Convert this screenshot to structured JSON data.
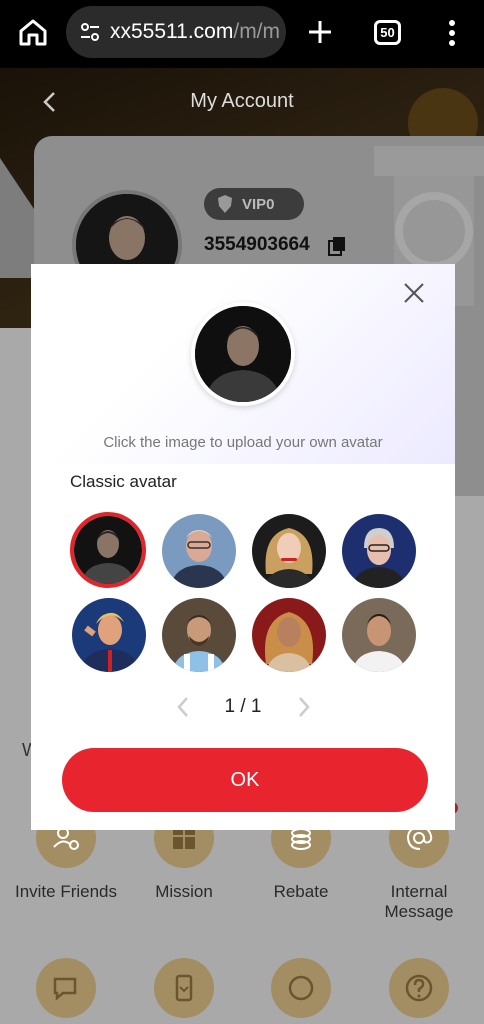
{
  "browser": {
    "url_host": "xx55511.com",
    "url_path": "/m/m",
    "tab_count": "50"
  },
  "app": {
    "title": "My Account",
    "vip_level": "VIP0",
    "user_id": "3554903664",
    "partial_label": "W",
    "menu": [
      {
        "label": "Invite Friends",
        "icon": "invite-user-icon"
      },
      {
        "label": "Mission",
        "icon": "gift-box-icon"
      },
      {
        "label": "Rebate",
        "icon": "coins-icon"
      },
      {
        "label": "Internal Message",
        "icon": "at-sign-icon"
      },
      {
        "icon": "feedback-chat-icon"
      },
      {
        "icon": "app-download-icon"
      },
      {
        "icon": "support-24-7-icon"
      },
      {
        "icon": "help-question-icon"
      }
    ]
  },
  "modal": {
    "upload_hint": "Click the image to upload your own avatar",
    "classic_label": "Classic avatar",
    "page_current": "1",
    "page_separator": "/",
    "page_total": "1",
    "ok_label": "OK",
    "avatars": [
      {
        "name": "avatar-1",
        "selected": true
      },
      {
        "name": "avatar-2",
        "selected": false
      },
      {
        "name": "avatar-3",
        "selected": false
      },
      {
        "name": "avatar-4",
        "selected": false
      },
      {
        "name": "avatar-5",
        "selected": false
      },
      {
        "name": "avatar-6",
        "selected": false
      },
      {
        "name": "avatar-7",
        "selected": false
      },
      {
        "name": "avatar-8",
        "selected": false
      }
    ]
  },
  "colors": {
    "accent_red": "#e8252e",
    "gold": "#a38e63"
  }
}
